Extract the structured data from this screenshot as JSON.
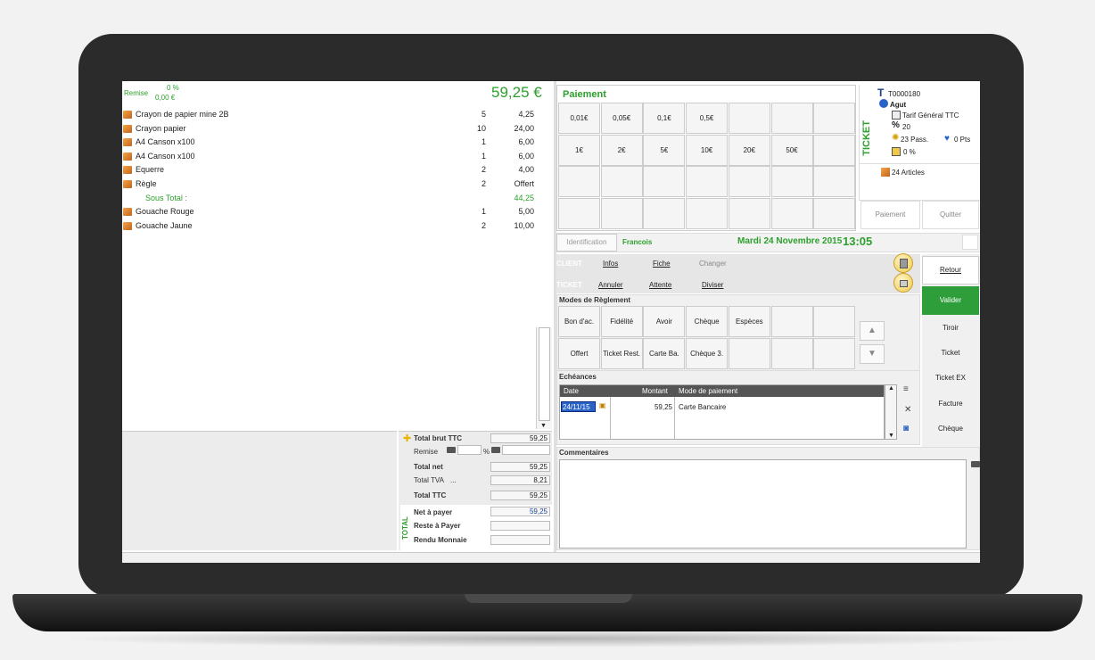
{
  "remise": {
    "label": "Remise",
    "percent": "0 %",
    "amount": "0,00 €"
  },
  "total_display": "59,25  €",
  "lines": [
    {
      "name": "Crayon de papier mine 2B",
      "qty": "5",
      "amount": "4,25",
      "type": "item"
    },
    {
      "name": "Crayon papier",
      "qty": "10",
      "amount": "24,00",
      "type": "item"
    },
    {
      "name": "A4 Canson x100",
      "qty": "1",
      "amount": "6,00",
      "type": "item"
    },
    {
      "name": "A4 Canson x100",
      "qty": "1",
      "amount": "6,00",
      "type": "item"
    },
    {
      "name": "Equerre",
      "qty": "2",
      "amount": "4,00",
      "type": "item"
    },
    {
      "name": "Règle",
      "qty": "2",
      "amount": "Offert",
      "type": "item"
    },
    {
      "name": "Sous Total :",
      "qty": "",
      "amount": "44,25",
      "type": "sub"
    },
    {
      "name": "Gouache Rouge",
      "qty": "1",
      "amount": "5,00",
      "type": "item"
    },
    {
      "name": "Gouache Jaune",
      "qty": "2",
      "amount": "10,00",
      "type": "item"
    }
  ],
  "totals": {
    "brut_label": "Total brut TTC",
    "brut": "59,25",
    "remise_label": "Remise",
    "remise_pct_sym": "%",
    "net_label": "Total net",
    "net": "59,25",
    "tva_label": "Total TVA",
    "tva_dots": "...",
    "tva": "8,21",
    "ttc_label": "Total TTC",
    "ttc": "59,25",
    "vertical_label": "TOTAL",
    "net_payer_label": "Net à payer",
    "net_payer": "59,25",
    "reste_label": "Reste à Payer",
    "reste": "",
    "rendu_label": "Rendu Monnaie",
    "rendu": ""
  },
  "paiement": {
    "title": "Paiement",
    "grid": [
      [
        "0,01€",
        "0,05€",
        "0,1€",
        "0,5€",
        "",
        "",
        ""
      ],
      [
        "1€",
        "2€",
        "5€",
        "10€",
        "20€",
        "50€",
        ""
      ],
      [
        "",
        "",
        "",
        "",
        "",
        "",
        ""
      ],
      [
        "",
        "",
        "",
        "",
        "",
        "",
        ""
      ]
    ]
  },
  "ticket": {
    "vertical_label": "TICKET",
    "number": "T0000180",
    "user": "Agut",
    "tarif": "Tarif Général TTC",
    "percent_val": "20",
    "passages": "23 Pass.",
    "points": "0 Pts",
    "discount": "0 %",
    "articles": "24 Articles",
    "btn_paiement": "Paiement",
    "btn_quitter": "Quitter"
  },
  "ident": {
    "tab": "Identification",
    "client_name": "Francois",
    "date": "Mardi 24 Novembre 2015",
    "time": "13:05"
  },
  "client_actions": {
    "client_label": "CLIENT",
    "ticket_label": "TICKET",
    "infos": "Infos",
    "fiche": "Fiche",
    "changer": "Changer",
    "annuler": "Annuler",
    "attente": "Attente",
    "diviser": "Diviser"
  },
  "actions": {
    "retour": "Retour",
    "valider": "Valider",
    "tiroir": "Tiroir",
    "ticket": "Ticket",
    "ticket_ex": "Ticket EX",
    "facture": "Facture",
    "cheque": "Chèque"
  },
  "modes": {
    "title": "Modes de Règlement",
    "grid": [
      [
        "Bon d'ac.",
        "Fidélité",
        "Avoir",
        "Chèque",
        "Espèces",
        "",
        ""
      ],
      [
        "Offert",
        "Ticket Rest.",
        "Carte Ba.",
        "Chèque 3.",
        "",
        "",
        ""
      ]
    ],
    "up": "▲",
    "down": "▼"
  },
  "echeances": {
    "title": "Echéances",
    "headers": [
      "Date",
      "Montant",
      "Mode de paiement"
    ],
    "rows": [
      {
        "date": "24/11/15",
        "montant": "59,25",
        "mode": "Carte Bancaire"
      }
    ]
  },
  "commentaires": {
    "title": "Commentaires",
    "text": ""
  },
  "colors": {
    "accent_green": "#2ca02c",
    "valider_green": "#2e9e3a",
    "selection_blue": "#2a63c8"
  }
}
